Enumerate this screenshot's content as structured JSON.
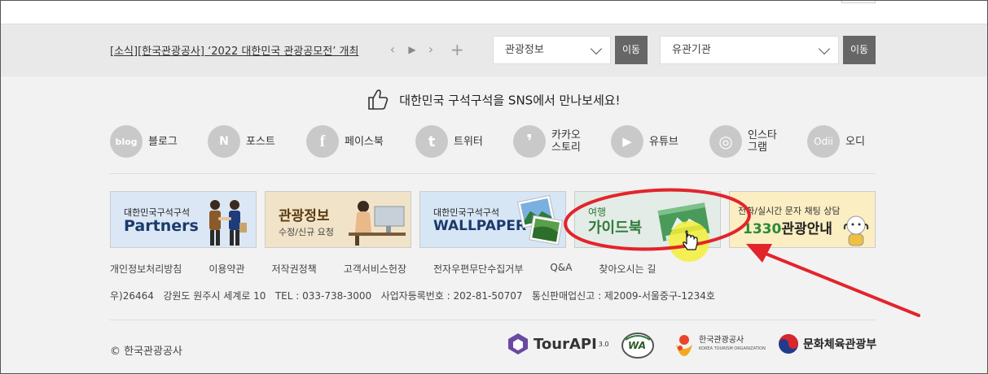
{
  "news": {
    "text": "[소식][한국관광공사] ‘2022 대한민국 관광공모전’ 개최",
    "prev": "‹",
    "play": "▶",
    "next": "›",
    "more": "+"
  },
  "selects": [
    {
      "value": "관광정보",
      "button": "이동"
    },
    {
      "value": "유관기관",
      "button": "이동"
    }
  ],
  "sns": {
    "title": "대한민국 구석구석을 SNS에서 만나보세요!",
    "items": [
      {
        "icon_text": "blog",
        "label": "블로그",
        "icon": "blog-icon"
      },
      {
        "icon_text": "N",
        "label": "포스트",
        "icon": "post-icon"
      },
      {
        "icon_text": "f",
        "label": "페이스북",
        "icon": "facebook-icon"
      },
      {
        "icon_text": "t",
        "label": "트위터",
        "icon": "twitter-icon"
      },
      {
        "icon_text": "❜",
        "label": "카카오\n스토리",
        "icon": "kakaostory-icon"
      },
      {
        "icon_text": "▶",
        "label": "유튜브",
        "icon": "youtube-icon"
      },
      {
        "icon_text": "◎",
        "label": "인스타\n그램",
        "icon": "instagram-icon"
      },
      {
        "icon_text": "Odii",
        "label": "오디",
        "icon": "odii-icon"
      }
    ]
  },
  "banners": {
    "partners": {
      "line1": "대한민국구석구석",
      "line2": "Partners"
    },
    "tourinfo": {
      "line1": "관광정보",
      "line2": "수정/신규 요청"
    },
    "wallpaper": {
      "line1": "대한민국구석구석",
      "line2": "WALLPAPER"
    },
    "guidebook": {
      "line1": "여행",
      "line2": "가이드북"
    },
    "call": {
      "line1": "전화/실시간 문자 채팅 상담",
      "line2_num": "1330",
      "line2_text": "관광안내"
    }
  },
  "footer": {
    "links": [
      "개인정보처리방침",
      "이용약관",
      "저작권정책",
      "고객서비스헌장",
      "전자우편무단수집거부",
      "Q&A",
      "찾아오시는 길"
    ],
    "address": "우)26464   강원도 원주시 세계로 10   TEL : 033-738-3000   사업자등록번호 : 202-81-50707   통신판매업신고 : 제2009-서울중구-1234호",
    "copyright": "© 한국관광공사",
    "logos": {
      "tourapi": "TourAPI",
      "tourapi_ver": "3.0",
      "wa": "WA",
      "kto_kr": "한국관광공사",
      "kto_en": "KOREA TOURISM ORGANIZATION",
      "ministry": "문화체육관광부"
    }
  },
  "colors": {
    "annotation_red": "#e3242b",
    "cursor_highlight": "#f5ee3a",
    "go_button": "#666666",
    "brand_navy": "#1b3a6b"
  }
}
